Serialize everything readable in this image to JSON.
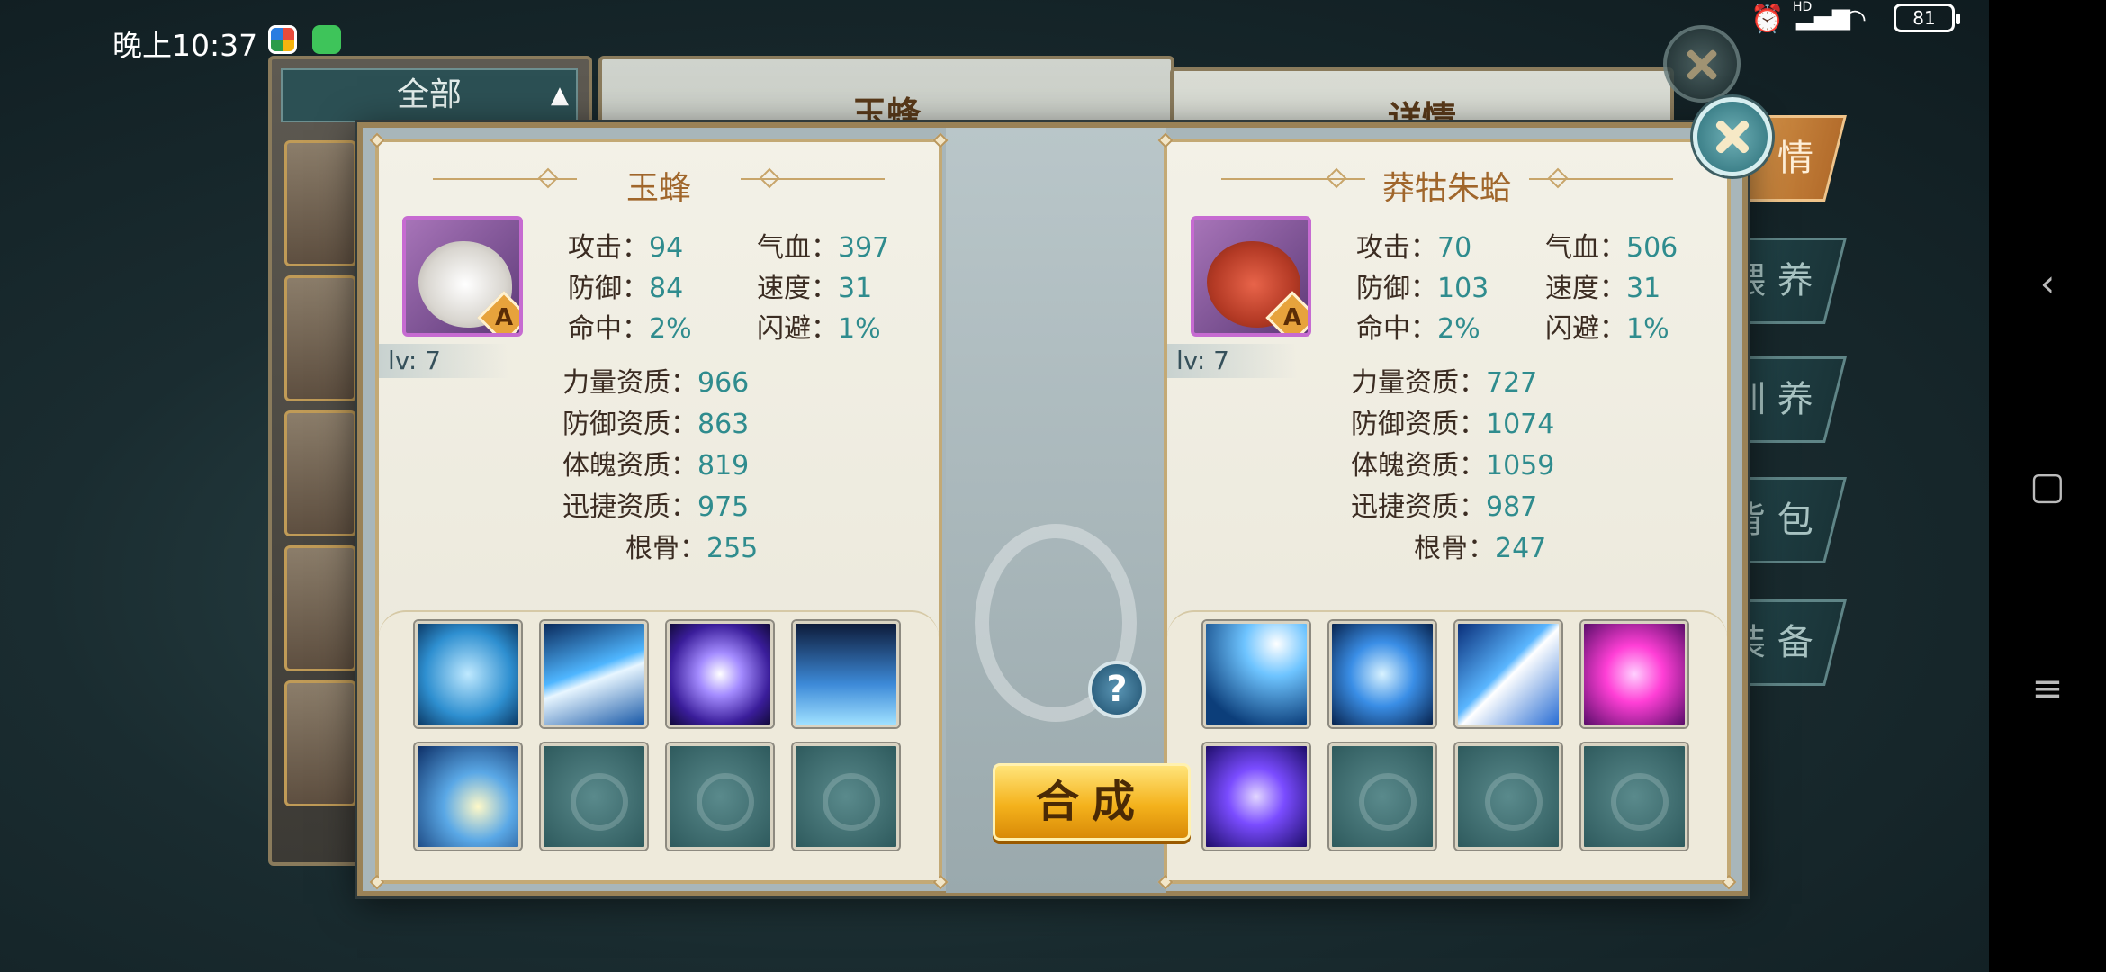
{
  "status_bar": {
    "time": "晚上10:37",
    "network": "HD",
    "battery": "81"
  },
  "background": {
    "filter_label": "全部",
    "middle_title": "玉蜂",
    "right_title": "详情",
    "tabs": [
      "情",
      "喂 养",
      "训 养",
      "背 包",
      "装 备"
    ]
  },
  "left_pet": {
    "name": "玉蜂",
    "grade": "A",
    "level": "lv: 7",
    "attack_label": "攻击：",
    "attack": "94",
    "hp_label": "气血：",
    "hp": "397",
    "defense_label": "防御：",
    "defense": "84",
    "speed_label": "速度：",
    "speed": "31",
    "hit_label": "命中：",
    "hit": "2%",
    "dodge_label": "闪避：",
    "dodge": "1%",
    "str_apt_label": "力量资质：",
    "str_apt": "966",
    "def_apt_label": "防御资质：",
    "def_apt": "863",
    "con_apt_label": "体魄资质：",
    "con_apt": "819",
    "agi_apt_label": "迅捷资质：",
    "agi_apt": "975",
    "bone_label": "根骨：",
    "bone": "255",
    "skills": [
      "blade-orb-skill-icon",
      "light-streak-skill-icon",
      "purple-orb-skill-icon",
      "ice-shard-skill-icon",
      "lightning-crescent-skill-icon",
      "empty",
      "empty",
      "empty"
    ]
  },
  "right_pet": {
    "name": "莽牯朱蛤",
    "grade": "A",
    "level": "lv: 7",
    "attack_label": "攻击：",
    "attack": "70",
    "hp_label": "气血：",
    "hp": "506",
    "defense_label": "防御：",
    "defense": "103",
    "speed_label": "速度：",
    "speed": "31",
    "hit_label": "命中：",
    "hit": "2%",
    "dodge_label": "闪避：",
    "dodge": "1%",
    "str_apt_label": "力量资质：",
    "str_apt": "727",
    "def_apt_label": "防御资质：",
    "def_apt": "1074",
    "con_apt_label": "体魄资质：",
    "con_apt": "1059",
    "agi_apt_label": "迅捷资质：",
    "agi_apt": "987",
    "bone_label": "根骨：",
    "bone": "247",
    "skills": [
      "thunder-skill-icon",
      "water-heart-skill-icon",
      "lightning-bolt-skill-icon",
      "pink-vortex-skill-icon",
      "purple-vortex-skill-icon",
      "empty",
      "empty",
      "empty"
    ]
  },
  "help_label": "?",
  "compose_label": "合成"
}
